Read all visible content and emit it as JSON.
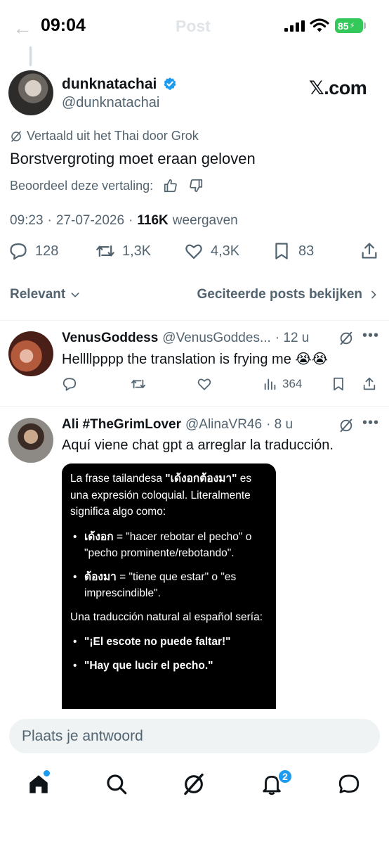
{
  "status_bar": {
    "time": "09:04",
    "battery": "85"
  },
  "nav": {
    "title": "Post"
  },
  "post": {
    "author_name": "dunknatachai",
    "author_handle": "@dunknatachai",
    "source_logo": "𝕏.com",
    "translated_label": "Vertaald uit het Thai door Grok",
    "text": "Borstvergroting moet eraan geloven",
    "rate_label": "Beoordeel deze vertaling:",
    "time": "09:23",
    "date": "27-07-2026",
    "views_count": "116K",
    "views_label": "weergaven",
    "sep": "·",
    "replies": "128",
    "reposts": "1,3K",
    "likes": "4,3K",
    "bookmarks": "83"
  },
  "sort": {
    "left": "Relevant",
    "right": "Geciteerde posts bekijken"
  },
  "replies": [
    {
      "name": "VenusGoddess",
      "handle": "@VenusGoddes...",
      "time": "· 12 u",
      "text": "Hellllpppp the translation is frying me 😭😭",
      "views": "364"
    },
    {
      "name": "Ali #TheGrimLover",
      "handle": "@AlinaVR46",
      "time": "· 8 u",
      "text": "Aquí viene chat gpt a arreglar la traducción.",
      "image": {
        "p1_a": "La frase tailandesa ",
        "p1_b": "\"เด้งอกต้องมา\"",
        "p1_c": " es una expresión coloquial. Literalmente significa algo como:",
        "li1_b": "เด้งอก",
        "li1_c": " = \"hacer rebotar el pecho\" o \"pecho prominente/rebotando\".",
        "li2_b": "ต้องมา",
        "li2_c": " = \"tiene que estar\" o \"es imprescindible\".",
        "p2": "Una traducción natural al español sería:",
        "li3": "\"¡El escote no puede faltar!\"",
        "li4": "\"Hay que lucir el pecho.\""
      }
    }
  ],
  "composer": {
    "placeholder": "Plaats je antwoord"
  },
  "bottom_nav": {
    "notifications_badge": "2"
  },
  "colors": {
    "accent": "#1d9bf0",
    "secondary_text": "#536471",
    "battery": "#34c759"
  }
}
